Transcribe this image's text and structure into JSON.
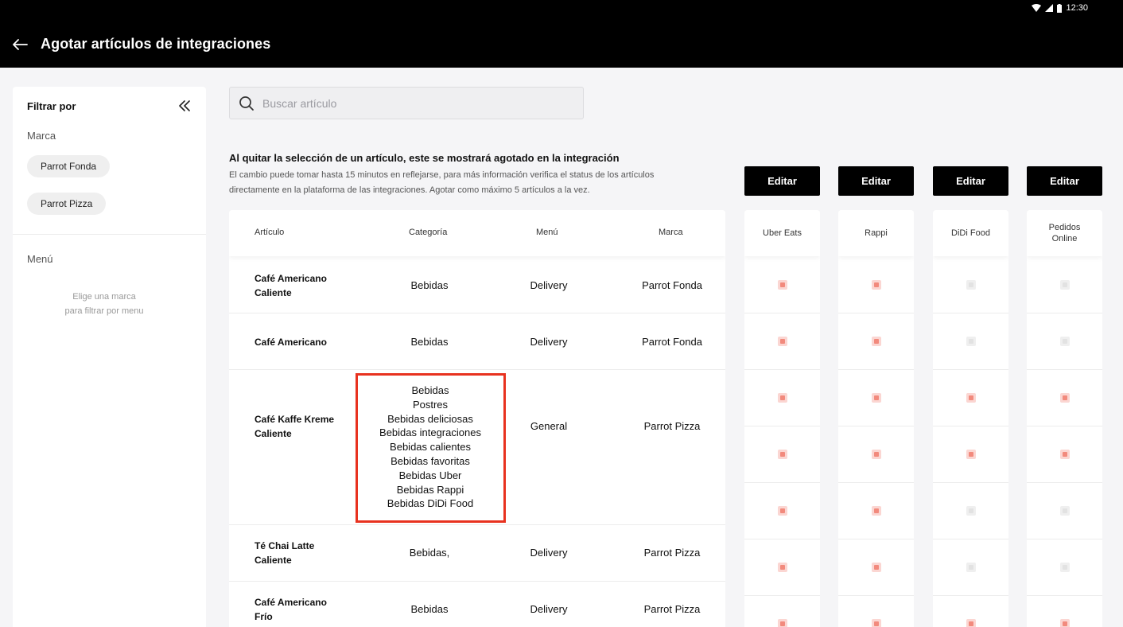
{
  "status_bar": {
    "time": "12:30"
  },
  "header": {
    "title": "Agotar artículos de integraciones"
  },
  "sidebar": {
    "title": "Filtrar por",
    "brand_label": "Marca",
    "brands": [
      "Parrot Fonda",
      "Parrot Pizza"
    ],
    "menu_label": "Menú",
    "menu_hint_line1": "Elige una marca",
    "menu_hint_line2": "para filtrar por menu"
  },
  "search": {
    "placeholder": "Buscar artículo"
  },
  "info": {
    "title": "Al quitar la selección de un artículo, este se mostrará agotado en la integración",
    "line1": "El cambio puede tomar hasta 15 minutos en reflejarse, para más información verifica el status de los artículos",
    "line2": "directamente en la plataforma de las integraciones. Agotar como máximo 5 artículos a la vez."
  },
  "table": {
    "columns": [
      "Artículo",
      "Categoría",
      "Menú",
      "Marca"
    ],
    "rows": [
      {
        "article_l1": "Café Americano",
        "article_l2": "Caliente",
        "category": "Bebidas",
        "menu": "Delivery",
        "brand": "Parrot Fonda"
      },
      {
        "article_l1": "Café Americano",
        "article_l2": "",
        "category": "Bebidas",
        "menu": "Delivery",
        "brand": "Parrot Fonda"
      },
      {
        "article_l1": "Café Kaffe Kreme",
        "article_l2": "Caliente",
        "categories": [
          "Bebidas",
          "Postres",
          "Bebidas deliciosas",
          "Bebidas integraciones",
          "Bebidas calientes",
          "Bebidas favoritas",
          "Bebidas Uber",
          "Bebidas Rappi",
          "Bebidas DiDi Food"
        ],
        "menu": "General",
        "brand": "Parrot Pizza"
      },
      {
        "article_l1": "Té Chai Latte",
        "article_l2": "Caliente",
        "category": "Bebidas,",
        "menu": "Delivery",
        "brand": "Parrot Pizza"
      },
      {
        "article_l1": "Café Americano",
        "article_l2": "Frío",
        "category": "Bebidas",
        "menu": "Delivery",
        "brand": "Parrot Pizza"
      }
    ]
  },
  "integrations": [
    {
      "name_l1": "Uber Eats",
      "name_l2": "",
      "edit_label": "Editar",
      "states": [
        true,
        true,
        true,
        true,
        true,
        true,
        true
      ]
    },
    {
      "name_l1": "Rappi",
      "name_l2": "",
      "edit_label": "Editar",
      "states": [
        true,
        true,
        true,
        true,
        true,
        true,
        true
      ]
    },
    {
      "name_l1": "DiDi Food",
      "name_l2": "",
      "edit_label": "Editar",
      "states": [
        false,
        false,
        true,
        true,
        false,
        false,
        true
      ]
    },
    {
      "name_l1": "Pedidos",
      "name_l2": "Online",
      "edit_label": "Editar",
      "states": [
        false,
        false,
        true,
        true,
        false,
        false,
        true
      ]
    }
  ],
  "colors": {
    "accent": "#e8321f",
    "checkbox_on": "#f28a7d",
    "header_bg": "#000000"
  }
}
